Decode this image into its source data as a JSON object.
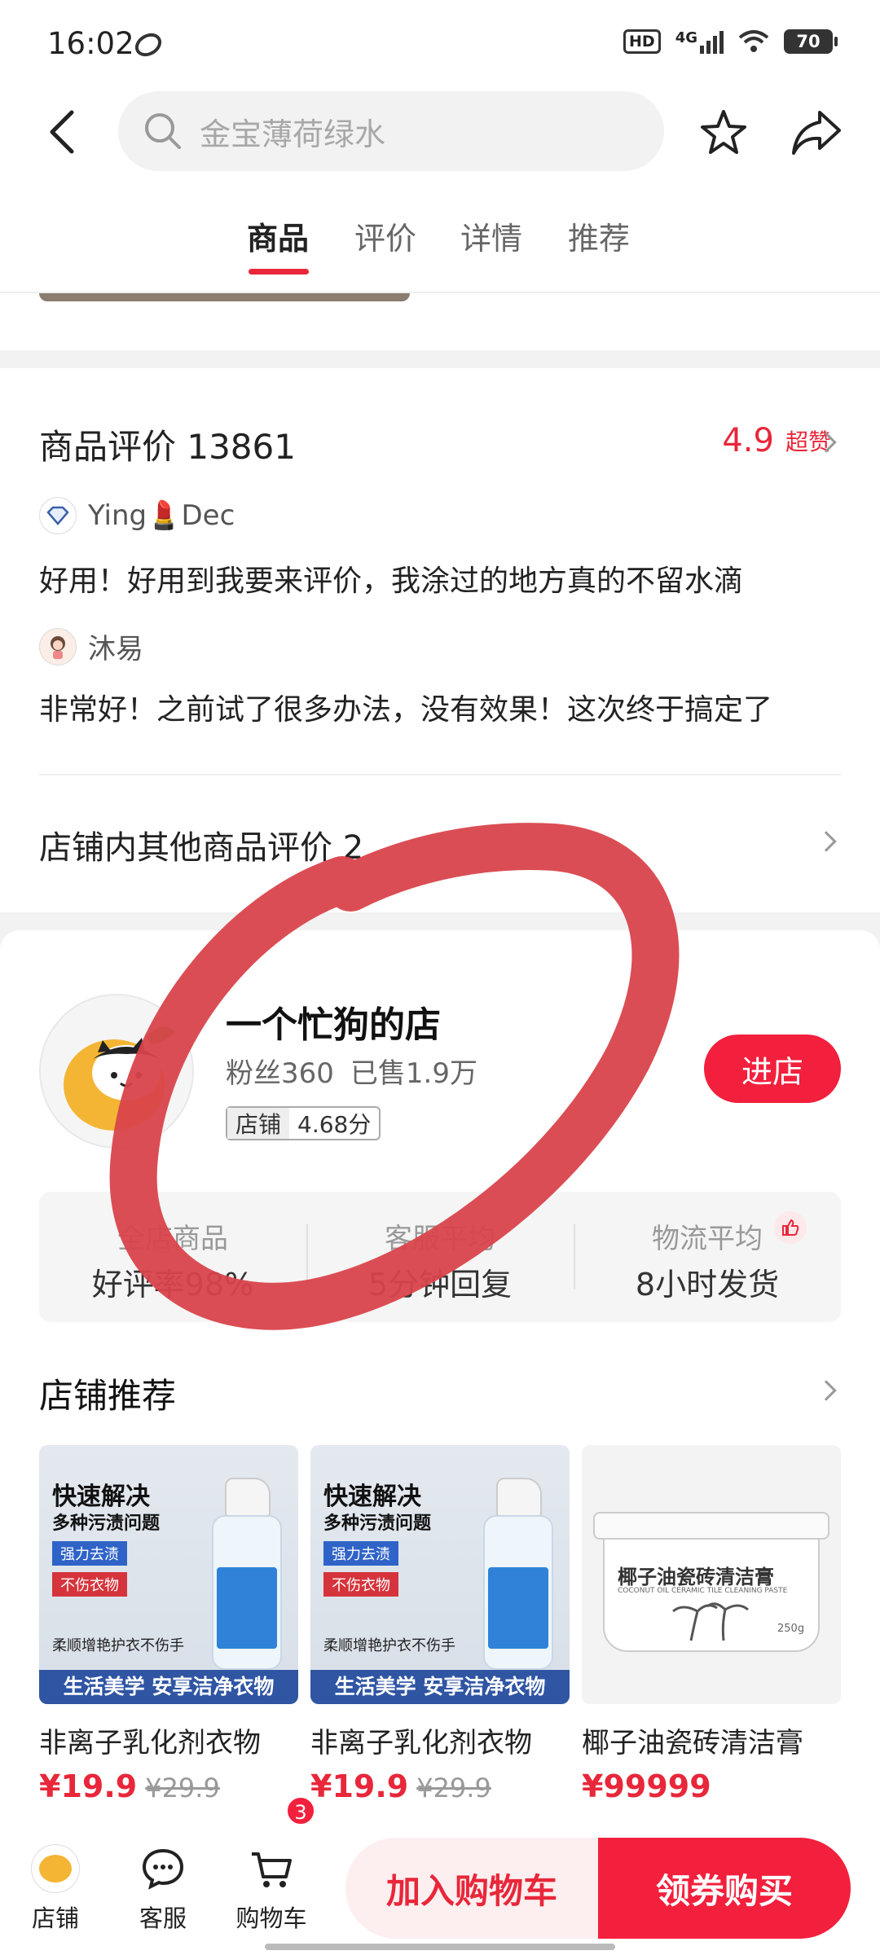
{
  "status_bar": {
    "time": "16:02",
    "network": "4G",
    "hd": "HD",
    "battery": "70"
  },
  "header": {
    "search_placeholder": "金宝薄荷绿水",
    "tabs": [
      {
        "label": "商品",
        "active": true
      },
      {
        "label": "评价",
        "active": false
      },
      {
        "label": "详情",
        "active": false
      },
      {
        "label": "推荐",
        "active": false
      }
    ]
  },
  "reviews": {
    "title": "商品评价 13861",
    "rating": "4.9",
    "rating_label": "超赞",
    "items": [
      {
        "user": "Ying💄Dec",
        "text": "好用！好用到我要来评价，我涂过的地方真的不留水滴"
      },
      {
        "user": "沐易",
        "text": "非常好！之前试了很多办法，没有效果！这次终于搞定了"
      }
    ],
    "other_reviews": "店铺内其他商品评价 2"
  },
  "shop": {
    "name": "一个忙狗的店",
    "fans": "粉丝360",
    "sold": "已售1.9万",
    "score_label": "店铺",
    "score_value": "4.68分",
    "enter_button": "进店",
    "stats": [
      {
        "top": "全店商品",
        "bottom": "好评率98%"
      },
      {
        "top": "客服平均",
        "bottom": "5分钟回复"
      },
      {
        "top": "物流平均",
        "bottom": "8小时发货"
      }
    ]
  },
  "recommend": {
    "title": "店铺推荐",
    "products": [
      {
        "name": "非离子乳化剂衣物",
        "price": "¥19.9",
        "old_price": "¥29.9",
        "img_title1": "快速解决",
        "img_title2": "多种污渍问题",
        "img_tag1": "强力去渍",
        "img_tag2": "不伤衣物",
        "img_slogan": "柔顺增艳护衣不伤手",
        "img_footer": "生活美学 安享洁净衣物"
      },
      {
        "name": "非离子乳化剂衣物",
        "price": "¥19.9",
        "old_price": "¥29.9",
        "img_title1": "快速解决",
        "img_title2": "多种污渍问题",
        "img_tag1": "强力去渍",
        "img_tag2": "不伤衣物",
        "img_slogan": "柔顺增艳护衣不伤手",
        "img_footer": "生活美学 安享洁净衣物"
      },
      {
        "name": "椰子油瓷砖清洁膏",
        "price": "¥99999",
        "old_price": "",
        "img_label": "椰子油瓷砖清洁膏",
        "img_sub": "COCONUT OIL CERAMIC TILE CLEANING PASTE",
        "img_weight": "250g"
      }
    ]
  },
  "bottom_bar": {
    "shop": "店铺",
    "service": "客服",
    "cart": "购物车",
    "cart_count": "3",
    "add_to_cart": "加入购物车",
    "buy": "领券购买"
  },
  "colors": {
    "accent": "#f2203d",
    "annotation": "#d9434b"
  }
}
